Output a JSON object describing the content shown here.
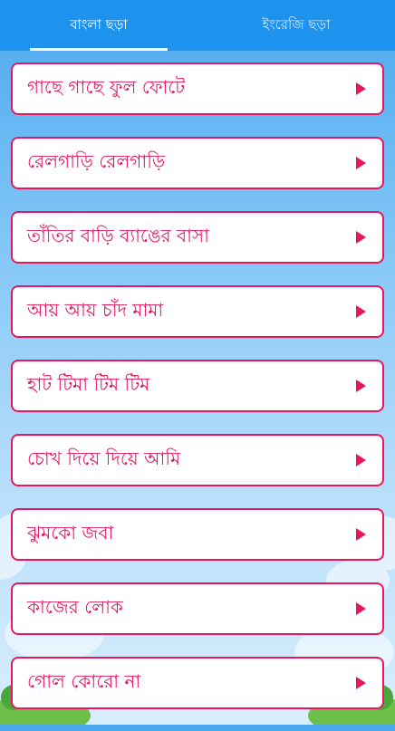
{
  "tabs": [
    {
      "label": "বাংলা ছড়া",
      "active": true
    },
    {
      "label": "ইংরেজি ছড়া",
      "active": false
    }
  ],
  "rhymes": [
    {
      "label": "গাছে গাছে ফুল ফোটে"
    },
    {
      "label": "রেলগাড়ি রেলগাড়ি"
    },
    {
      "label": "তাঁতির বাড়ি ব্যাঙের বাসা"
    },
    {
      "label": "আয় আয় চাঁদ মামা"
    },
    {
      "label": "হাট টিমা টিম টিম"
    },
    {
      "label": "চোখ দিয়ে দিয়ে আমি"
    },
    {
      "label": "ঝুমকো জবা"
    },
    {
      "label": "কাজের লোক"
    },
    {
      "label": "গোল কোরো না"
    }
  ],
  "colors": {
    "accent": "#e8175d",
    "tabbar": "#1e93ee"
  },
  "icons": {
    "item_arrow": "play-triangle-icon"
  }
}
